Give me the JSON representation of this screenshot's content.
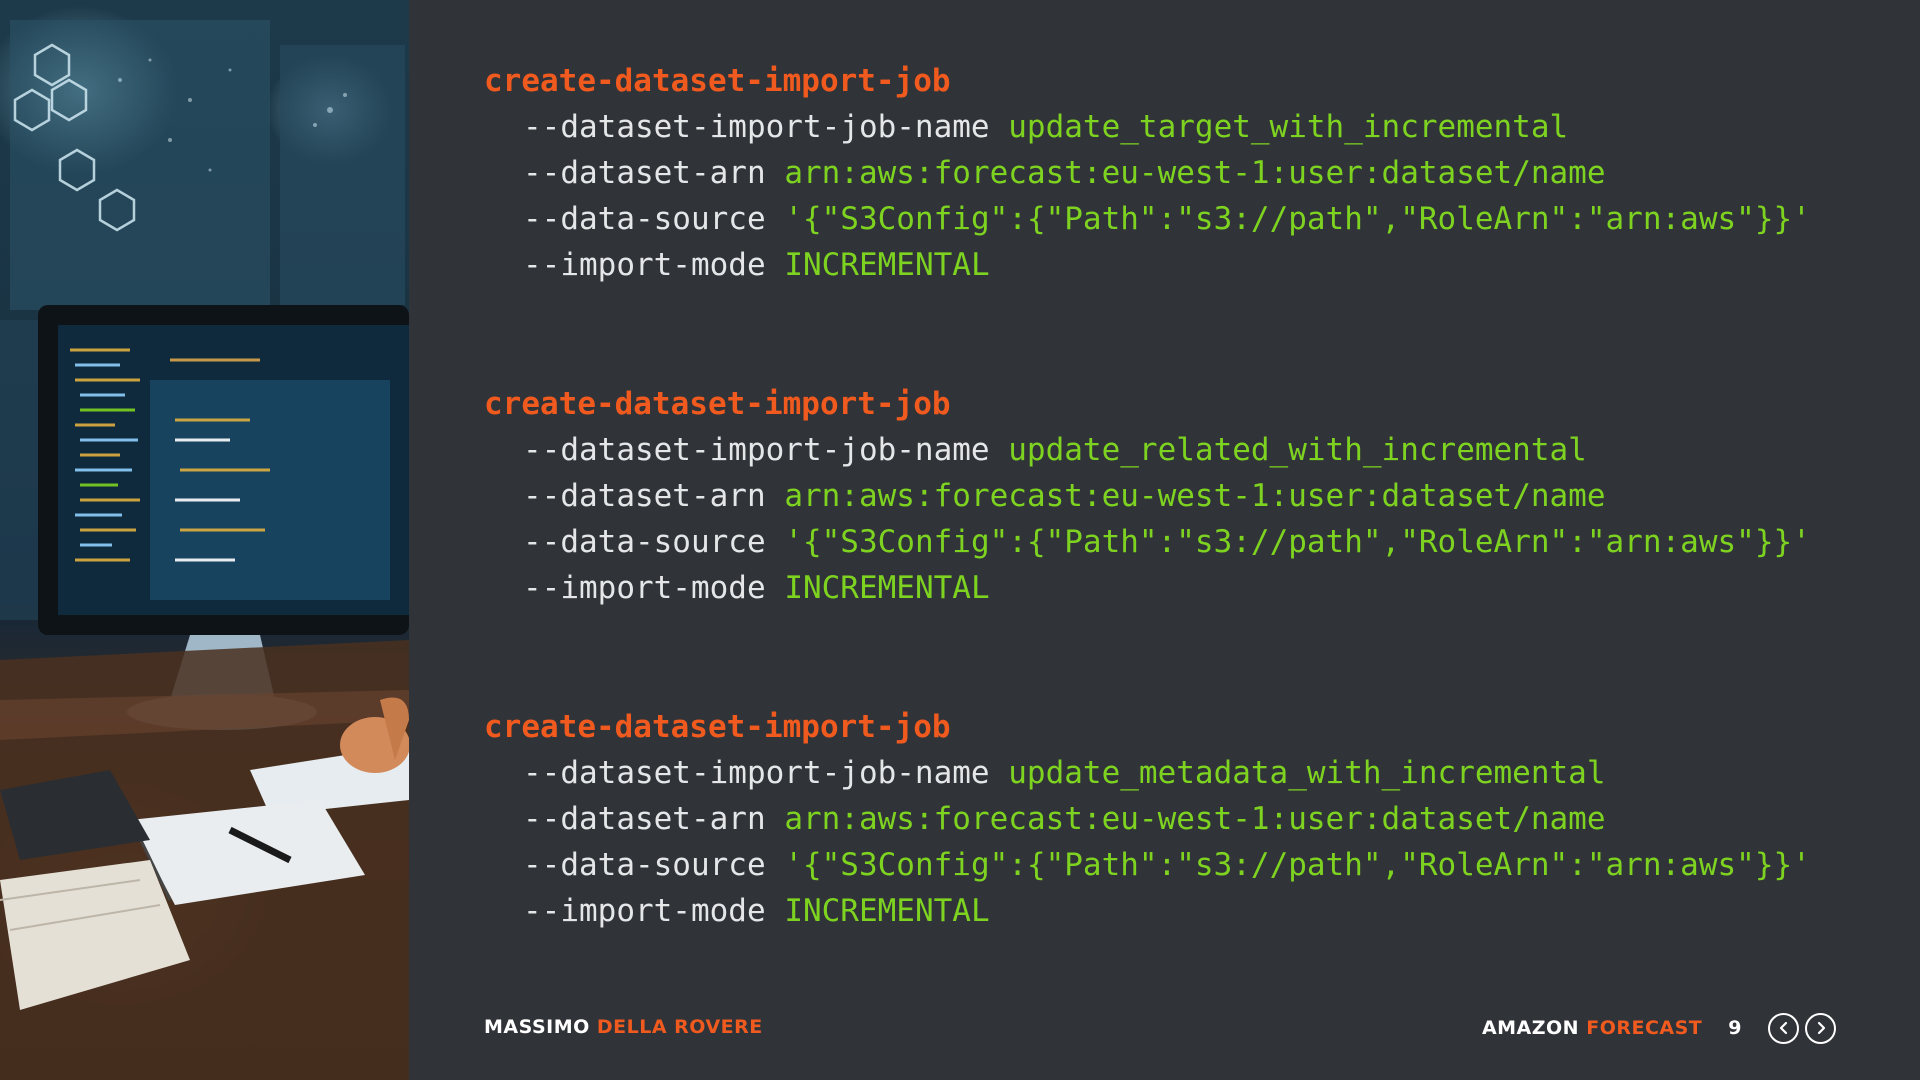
{
  "sections": [
    {
      "title": "create-dataset-import-job",
      "params": [
        {
          "flag": "--dataset-import-job-name",
          "value": "update_target_with_incremental"
        },
        {
          "flag": "--dataset-arn",
          "value": "arn:aws:forecast:eu-west-1:user:dataset/name"
        },
        {
          "flag": "--data-source",
          "value": "'{\"S3Config\":{\"Path\":\"s3://path\",\"RoleArn\":\"arn:aws\"}}'"
        },
        {
          "flag": "--import-mode",
          "value": "INCREMENTAL"
        }
      ]
    },
    {
      "title": "create-dataset-import-job",
      "params": [
        {
          "flag": "--dataset-import-job-name",
          "value": "update_related_with_incremental"
        },
        {
          "flag": "--dataset-arn",
          "value": "arn:aws:forecast:eu-west-1:user:dataset/name"
        },
        {
          "flag": "--data-source",
          "value": "'{\"S3Config\":{\"Path\":\"s3://path\",\"RoleArn\":\"arn:aws\"}}'"
        },
        {
          "flag": "--import-mode",
          "value": "INCREMENTAL"
        }
      ]
    },
    {
      "title": "create-dataset-import-job",
      "params": [
        {
          "flag": "--dataset-import-job-name",
          "value": "update_metadata_with_incremental"
        },
        {
          "flag": "--dataset-arn",
          "value": "arn:aws:forecast:eu-west-1:user:dataset/name"
        },
        {
          "flag": "--data-source",
          "value": "'{\"S3Config\":{\"Path\":\"s3://path\",\"RoleArn\":\"arn:aws\"}}'"
        },
        {
          "flag": "--import-mode",
          "value": "INCREMENTAL"
        }
      ]
    }
  ],
  "footer": {
    "author_first": "MASSIMO",
    "author_last": "DELLA ROVERE",
    "product_first": "AMAZON",
    "product_last": "FORECAST",
    "page": "9",
    "prev_icon": "chevron-left-circle-icon",
    "next_icon": "chevron-right-circle-icon"
  },
  "colors": {
    "background": "#303338",
    "accent": "#f05a1e",
    "value": "#7ed321",
    "text": "#e4e6e8"
  }
}
